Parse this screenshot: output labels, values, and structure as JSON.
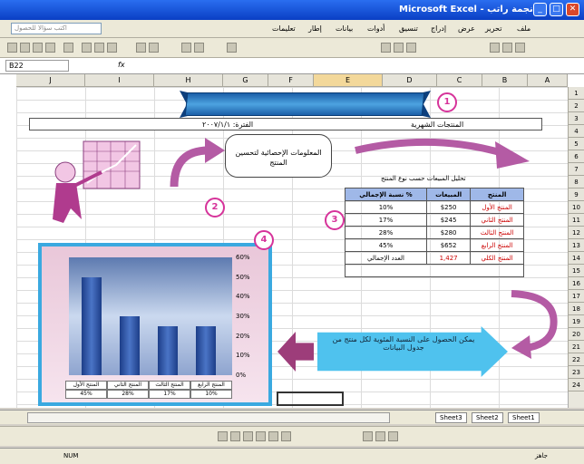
{
  "window": {
    "title": "Microsoft Excel - نجمة راتب"
  },
  "menu": {
    "items": [
      "ملف",
      "تحرير",
      "عرض",
      "إدراج",
      "تنسيق",
      "أدوات",
      "بيانات",
      "إطار",
      "تعليمات"
    ],
    "ask": "اكتب سؤالا للحصول"
  },
  "formula": {
    "cell": "B22",
    "fx": "fx"
  },
  "columns": [
    "J",
    "I",
    "H",
    "G",
    "F",
    "E",
    "D",
    "C",
    "B",
    "A"
  ],
  "rows": [
    "1",
    "2",
    "3",
    "4",
    "5",
    "6",
    "7",
    "8",
    "9",
    "10",
    "11",
    "12",
    "13",
    "14",
    "15",
    "16",
    "17",
    "18",
    "19",
    "20",
    "21",
    "22",
    "23",
    "24"
  ],
  "sheet": {
    "banner": "",
    "header_left": "الفترة: ٢٠٠٧/١/١",
    "header_right": "المنتجات الشهرية",
    "bubble": "المعلومات الإحصائية لتحسين المنتج",
    "table_title": "تحليل المبيعات حسب نوع المنتج",
    "table": {
      "headers": [
        "المنتج",
        "المبيعات",
        "نسبة الإجمالي %"
      ],
      "rows": [
        [
          "المنتج الأول",
          "$250",
          "10%"
        ],
        [
          "المنتج الثاني",
          "$245",
          "17%"
        ],
        [
          "المنتج الثالث",
          "$280",
          "28%"
        ],
        [
          "المنتج الرابع",
          "$652",
          "45%"
        ]
      ],
      "total_label": "المنتج الكلي",
      "total_value": "1,427",
      "total_note": "العدد الإجمالي"
    },
    "arrow_text": "يمكن الحصول على النسبة المئوية لكل منتج من جدول البيانات",
    "callouts": [
      "1",
      "2",
      "3",
      "4"
    ]
  },
  "chart_data": {
    "type": "bar",
    "categories": [
      "المنتج الأول",
      "المنتج الثاني",
      "المنتج الثالث",
      "المنتج الرابع"
    ],
    "values": [
      50,
      30,
      25,
      25
    ],
    "y_ticks": [
      "0%",
      "10%",
      "20%",
      "30%",
      "40%",
      "50%",
      "60%"
    ],
    "ylim": [
      0,
      60
    ],
    "legend_values": [
      "45%",
      "28%",
      "17%",
      "10%"
    ]
  },
  "tabs": {
    "sheet1": "Sheet1",
    "sheet2": "Sheet2",
    "sheet3": "Sheet3"
  },
  "status": {
    "left": "NUM",
    "right": "جاهز"
  },
  "colors": {
    "accent": "#b45ba4",
    "banner": "#1b5fa8",
    "arrow": "#4fc2ee"
  }
}
